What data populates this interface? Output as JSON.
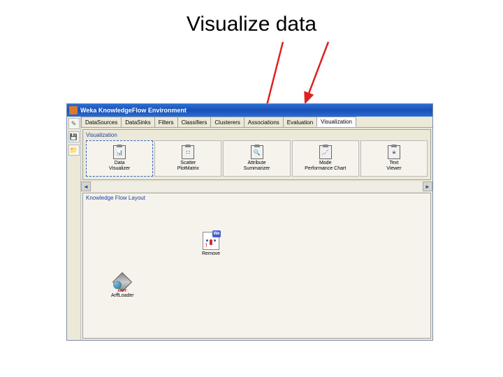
{
  "slide": {
    "title": "Visualize data"
  },
  "window": {
    "title": "Weka KnowledgeFlow Environment"
  },
  "tabs": [
    {
      "label": "DataSources"
    },
    {
      "label": "DataSinks"
    },
    {
      "label": "Filters"
    },
    {
      "label": "Classifiers"
    },
    {
      "label": "Clusterers"
    },
    {
      "label": "Associations"
    },
    {
      "label": "Evaluation"
    },
    {
      "label": "Visualization"
    }
  ],
  "viz_panel": {
    "title": "Visualization",
    "items": [
      {
        "label1": "Data",
        "label2": "Visualizer",
        "glyph": "📊"
      },
      {
        "label1": "Scatter",
        "label2": "PlotMatrix",
        "glyph": "∷"
      },
      {
        "label1": "Attribute",
        "label2": "Summarizer",
        "glyph": "🔍"
      },
      {
        "label1": "Mode",
        "label2": "Performance Chart",
        "glyph": "📈"
      },
      {
        "label1": "Text",
        "label2": "Viewer",
        "glyph": "≡"
      }
    ]
  },
  "layout": {
    "title": "Knowledge Flow Layout",
    "nodes": {
      "arff": {
        "label": "ArffLoader",
        "tag": "ARFF"
      },
      "remove": {
        "label": "Remove",
        "badge": "We"
      }
    }
  },
  "toolbar": {
    "btn1": "✎",
    "btn2": "💾",
    "btn3": "📁"
  },
  "scroll": {
    "left": "◄",
    "right": "►"
  }
}
